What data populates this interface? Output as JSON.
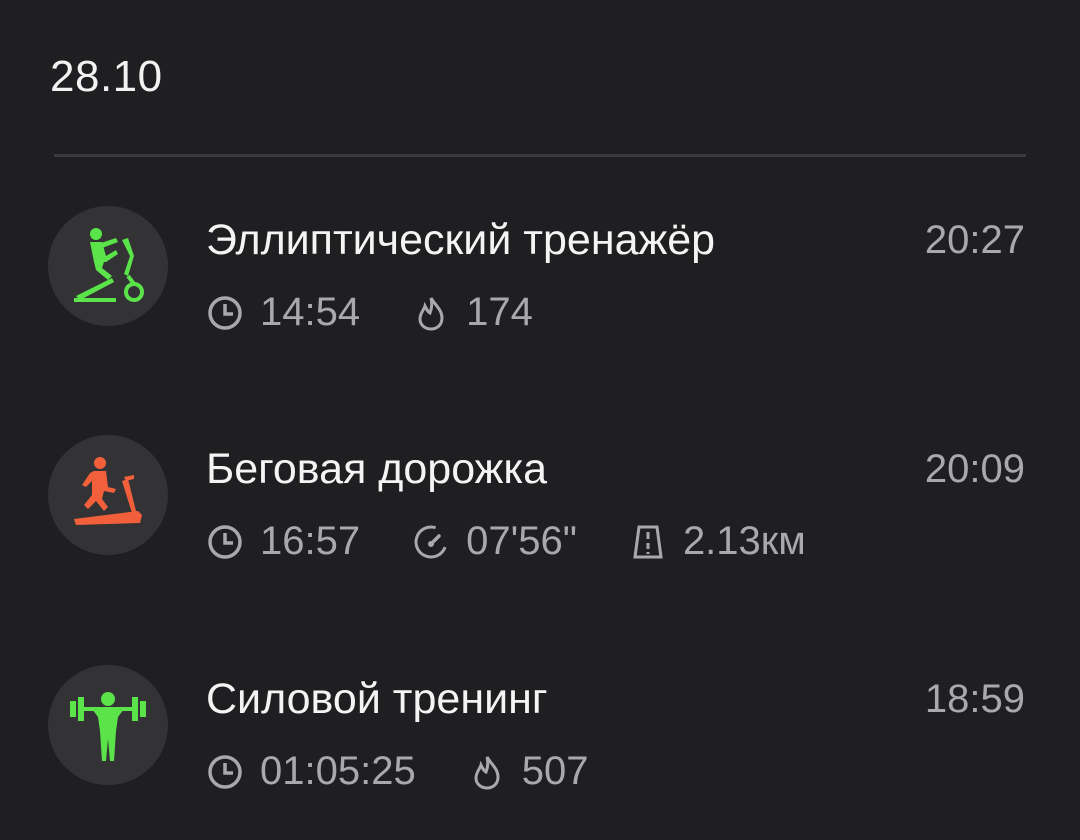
{
  "date": "28.10",
  "colors": {
    "background": "#1f1f21",
    "avatar_bg": "#333335",
    "green": "#5be34a",
    "orange": "#f2603b",
    "secondary_text": "#a9a9ab"
  },
  "workouts": [
    {
      "title": "Эллиптический тренажёр",
      "time": "20:27",
      "icon": "elliptical-trainer-icon",
      "duration": "14:54",
      "calories": "174"
    },
    {
      "title": "Беговая дорожка",
      "time": "20:09",
      "icon": "treadmill-icon",
      "duration": "16:57",
      "pace": "07'56\"",
      "distance": "2.13км"
    },
    {
      "title": "Силовой тренинг",
      "time": "18:59",
      "icon": "strength-training-icon",
      "duration": "01:05:25",
      "calories": "507"
    }
  ]
}
